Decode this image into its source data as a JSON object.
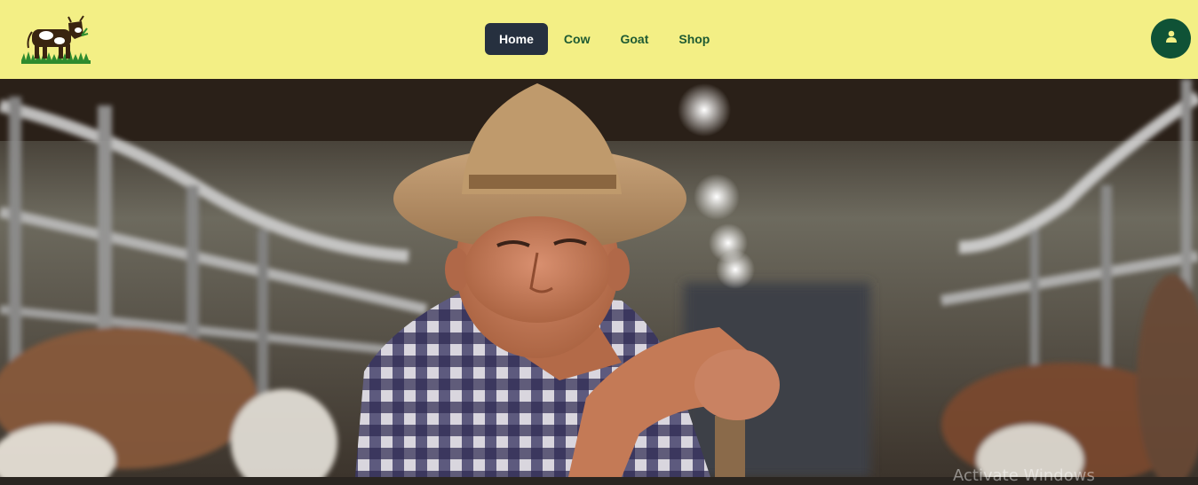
{
  "brand": {
    "logo_icon": "cow-on-grass-logo",
    "logo_alt": "Farm logo"
  },
  "nav": {
    "items": [
      {
        "label": "Home",
        "active": true
      },
      {
        "label": "Cow",
        "active": false
      },
      {
        "label": "Goat",
        "active": false
      },
      {
        "label": "Shop",
        "active": false
      }
    ]
  },
  "profile": {
    "icon": "user-icon"
  },
  "hero": {
    "image_alt": "Smiling farmer in straw hat leaning on a stick inside a cow barn"
  },
  "system": {
    "watermark": "Activate Windows"
  },
  "colors": {
    "navbar_bg": "#f3ef85",
    "nav_text": "#1e5a32",
    "nav_active_bg": "#26303f",
    "nav_active_text": "#ffffff",
    "profile_bg": "#0f5236"
  }
}
